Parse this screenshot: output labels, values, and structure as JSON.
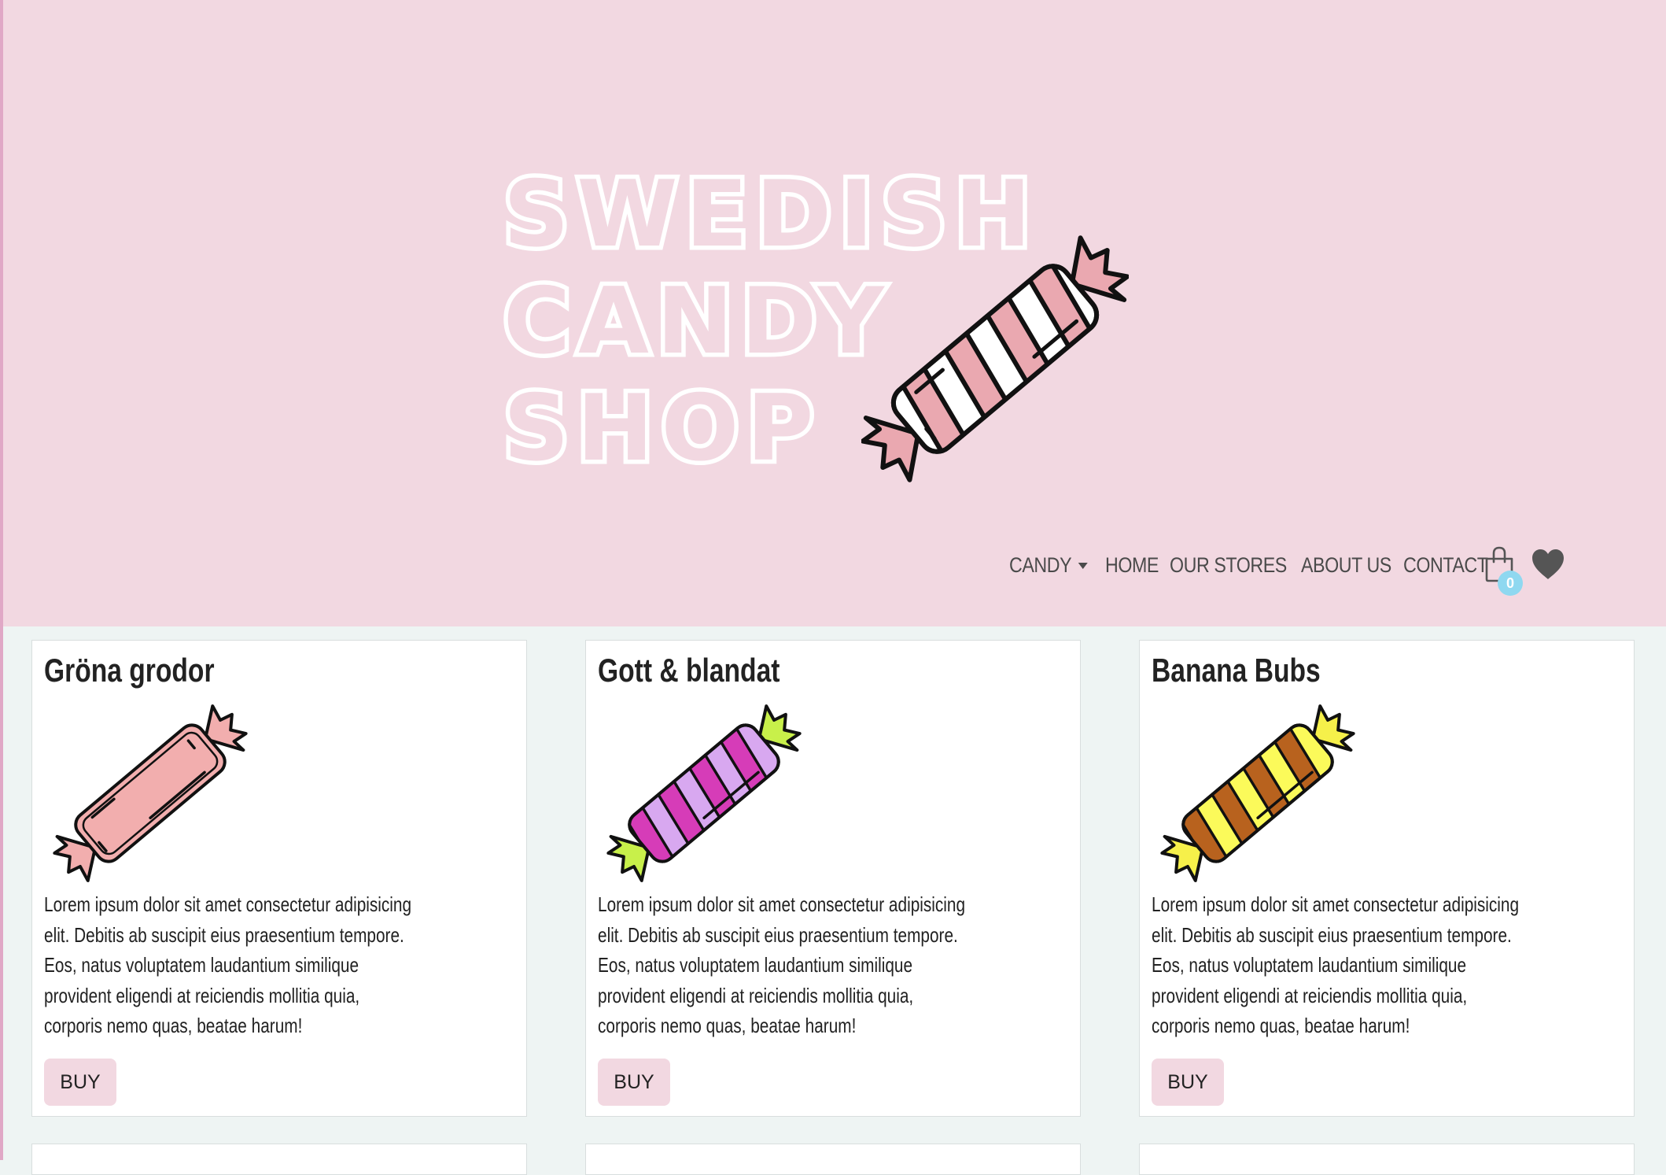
{
  "header": {
    "logo_lines": [
      "SWEDISH",
      "CANDY",
      "SHOP"
    ],
    "logo_icon": "striped-candy-icon"
  },
  "nav": {
    "items": [
      {
        "label": "CANDY",
        "dropdown": true
      },
      {
        "label": "HOME"
      },
      {
        "label": "OUR STORES"
      },
      {
        "label": "ABOUT US"
      },
      {
        "label": "CONTACT"
      }
    ],
    "cart_count": "0",
    "cart_icon": "shopping-bag-icon",
    "favorites_icon": "heart-icon"
  },
  "products": [
    {
      "name": "Gröna grodor",
      "image_icon": "pink-candy-icon",
      "description": "Lorem ipsum dolor sit amet consectetur adipisicing elit. Debitis ab suscipit eius praesentium tempore. Eos, natus voluptatem laudantium similique provident eligendi at reiciendis mollitia quia, corporis nemo quas, beatae harum!",
      "buy_label": "BUY"
    },
    {
      "name": "Gott & blandat",
      "image_icon": "purple-striped-candy-icon",
      "description": "Lorem ipsum dolor sit amet consectetur adipisicing elit. Debitis ab suscipit eius praesentium tempore. Eos, natus voluptatem laudantium similique provident eligendi at reiciendis mollitia quia, corporis nemo quas, beatae harum!",
      "buy_label": "BUY"
    },
    {
      "name": "Banana Bubs",
      "image_icon": "yellow-striped-candy-icon",
      "description": "Lorem ipsum dolor sit amet consectetur adipisicing elit. Debitis ab suscipit eius praesentium tempore. Eos, natus voluptatem laudantium similique provident eligendi at reiciendis mollitia quia, corporis nemo quas, beatae harum!",
      "buy_label": "BUY"
    }
  ],
  "colors": {
    "header_bg": "#f2d8e1",
    "page_bg": "#eef4f3",
    "button_bg": "#f2d8e1",
    "badge_bg": "#8fd8f0",
    "text": "#222222"
  }
}
